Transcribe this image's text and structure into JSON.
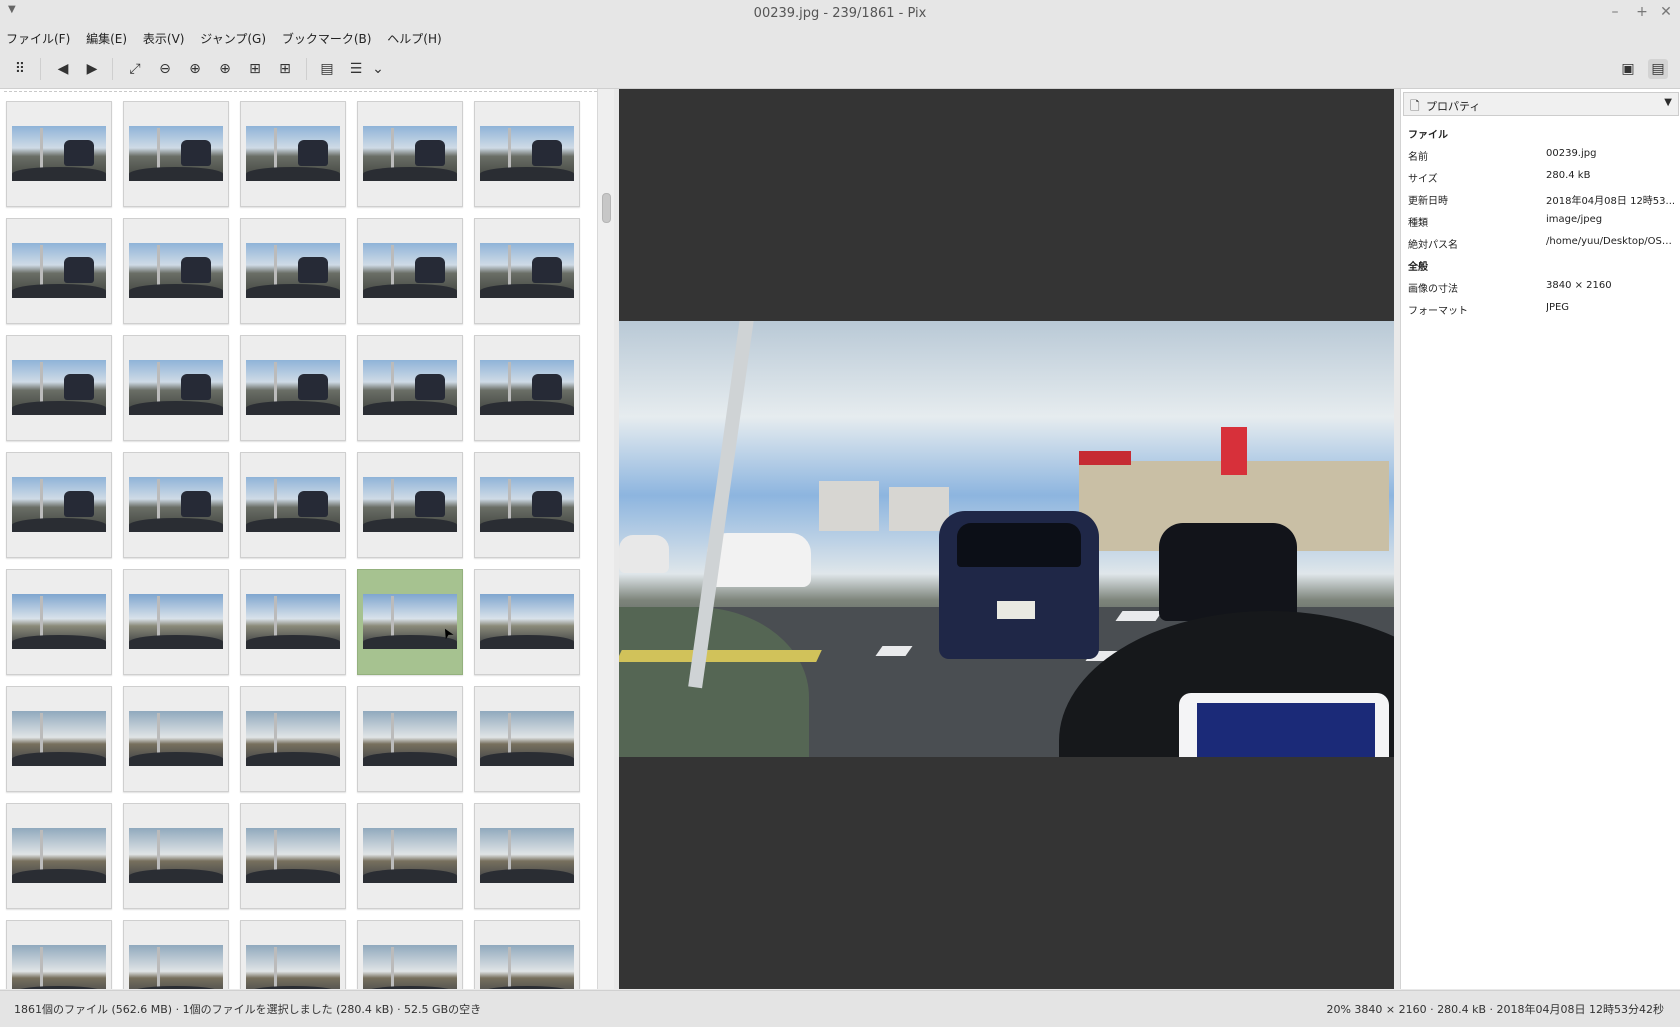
{
  "window": {
    "title": "00239.jpg - 239/1861 - Pix",
    "controls": {
      "minimize": "–",
      "maximize": "+",
      "close": "✕"
    }
  },
  "menu": [
    "ファイル(F)",
    "編集(E)",
    "表示(V)",
    "ジャンプ(G)",
    "ブックマーク(B)",
    "ヘルプ(H)"
  ],
  "toolbar": {
    "icons": [
      "grid-menu-icon",
      "back-icon",
      "forward-icon",
      "fullscreen-icon",
      "zoom-out-icon",
      "zoom-in-icon",
      "zoom-fit-icon",
      "grid-view-icon",
      "grid-view-alt-icon",
      "document-icon",
      "list-menu-icon",
      "dropdown-icon"
    ],
    "right_icons": [
      "image-view-icon",
      "properties-view-icon"
    ]
  },
  "thumbnails": {
    "rows": 8,
    "cols": 5,
    "selected_row": 4,
    "selected_col": 3
  },
  "properties": {
    "header": "プロパティ",
    "sections": [
      {
        "title": "ファイル",
        "rows": [
          {
            "k": "名前",
            "v": "00239.jpg"
          },
          {
            "k": "サイズ",
            "v": "280.4 kB"
          },
          {
            "k": "更新日時",
            "v": "2018年04月08日 12時53..."
          },
          {
            "k": "種類",
            "v": "image/jpeg"
          },
          {
            "k": "絶対パス名",
            "v": "/home/yuu/Desktop/OSM..."
          }
        ]
      },
      {
        "title": "全般",
        "rows": [
          {
            "k": "画像の寸法",
            "v": "3840 × 2160"
          },
          {
            "k": "フォーマット",
            "v": "JPEG"
          }
        ]
      }
    ]
  },
  "status": {
    "left": "1861個のファイル (562.6 MB) · 1個のファイルを選択しました (280.4 kB) · 52.5 GBの空き",
    "right": "20%  3840 × 2160 · 280.4 kB · 2018年04月08日 12時53分42秒"
  },
  "colors": {
    "selected": "#a6c290",
    "viewer_bg": "#343434"
  }
}
